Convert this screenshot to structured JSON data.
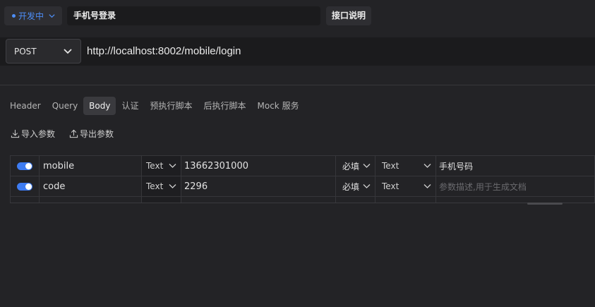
{
  "top": {
    "status_label": "开发中",
    "api_name": "手机号登录",
    "doc_button": "接口说明"
  },
  "request": {
    "method": "POST",
    "url": "http://localhost:8002/mobile/login"
  },
  "tabs": [
    {
      "label": "Header"
    },
    {
      "label": "Query"
    },
    {
      "label": "Body",
      "active": true
    },
    {
      "label": "认证"
    },
    {
      "label": "预执行脚本"
    },
    {
      "label": "后执行脚本"
    },
    {
      "label": "Mock 服务"
    }
  ],
  "tools": {
    "import_label": "导入参数",
    "export_label": "导出参数"
  },
  "params": [
    {
      "enabled": true,
      "name": "mobile",
      "type": "Text",
      "value": "13662301000",
      "required": "必填",
      "data_type": "Text",
      "description": "手机号码"
    },
    {
      "enabled": true,
      "name": "code",
      "type": "Text",
      "value": "2296",
      "required": "必填",
      "data_type": "Text",
      "description": "",
      "description_placeholder": "参数描述,用于生成文档"
    }
  ],
  "colors": {
    "accent": "#3e7cf2",
    "background": "#232326"
  }
}
